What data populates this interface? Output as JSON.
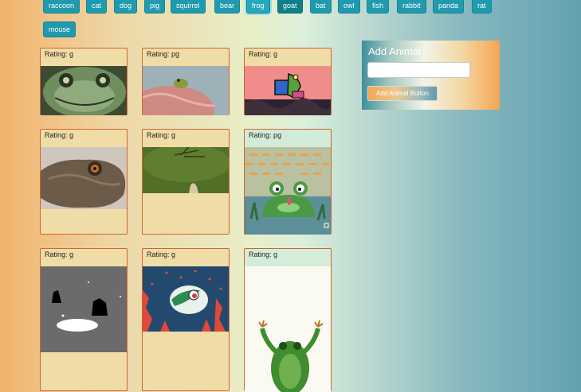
{
  "buttons": [
    "raccoon",
    "cat",
    "dog",
    "pig",
    "squirrel",
    "bear",
    "frog",
    "goat",
    "bat",
    "owl",
    "fish",
    "rabbit",
    "panda",
    "rat",
    "mouse"
  ],
  "cards": [
    {
      "rating": "Rating: g"
    },
    {
      "rating": "Rating: pg"
    },
    {
      "rating": "Rating: g"
    },
    {
      "rating": "Rating: g"
    },
    {
      "rating": "Rating: g"
    },
    {
      "rating": "Rating: pg"
    },
    {
      "rating": "Rating: g"
    },
    {
      "rating": "Rating: g"
    },
    {
      "rating": "Rating: g"
    }
  ],
  "panel": {
    "title": "Add Animal",
    "input_value": "",
    "button_label": "Add Animal Button"
  }
}
